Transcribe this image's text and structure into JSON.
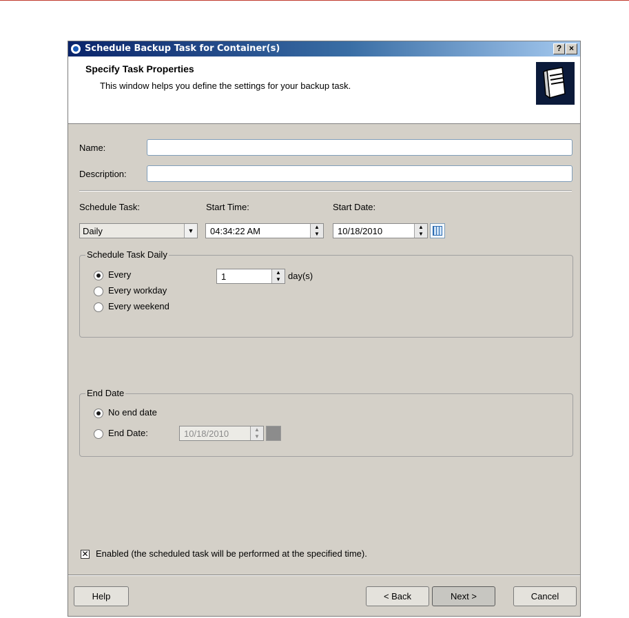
{
  "window": {
    "title": "Schedule Backup Task for Container(s)",
    "help_btn": "?",
    "close_btn": "×"
  },
  "header": {
    "title": "Specify Task Properties",
    "subtitle": "This window helps you define the settings for your backup task."
  },
  "form": {
    "name_label": "Name:",
    "name_value": "",
    "description_label": "Description:",
    "description_value": "",
    "schedule_label": "Schedule Task:",
    "schedule_value": "Daily",
    "start_time_label": "Start Time:",
    "start_time_value": "04:34:22 AM",
    "start_date_label": "Start Date:",
    "start_date_value": "10/18/2010"
  },
  "daily_group": {
    "legend": "Schedule Task Daily",
    "every_label": "Every",
    "every_value": "1",
    "every_unit": "day(s)",
    "workday_label": "Every workday",
    "weekend_label": "Every weekend",
    "selected": "every"
  },
  "end_group": {
    "legend": "End Date",
    "no_end_label": "No end date",
    "end_date_label": "End Date:",
    "end_date_value": "10/18/2010",
    "selected": "no_end"
  },
  "enabled": {
    "checked": true,
    "label": "Enabled (the scheduled task will be performed at the specified time)."
  },
  "buttons": {
    "help": "Help",
    "back": "< Back",
    "next": "Next >",
    "cancel": "Cancel"
  }
}
